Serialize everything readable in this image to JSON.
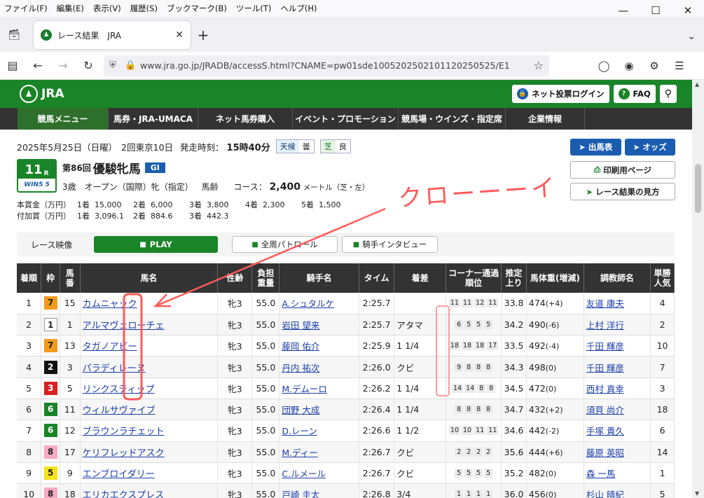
{
  "browser": {
    "menu": [
      "ファイル(F)",
      "編集(E)",
      "表示(V)",
      "履歴(S)",
      "ブックマーク(B)",
      "ツール(T)",
      "ヘルプ(H)"
    ],
    "tab_title": "レース結果　JRA",
    "url": "www.jra.go.jp/JRADB/accessS.html?CNAME=pw01sde1005202502101120250525/E1"
  },
  "site": {
    "logo": "JRA",
    "login_btn": "ネット投票ログイン",
    "faq_btn": "FAQ",
    "nav": [
      "競馬メニュー",
      "馬券・JRA-UMACA",
      "ネット馬券購入",
      "イベント・プロモーション",
      "競馬場・ウインズ・指定席",
      "企業情報"
    ]
  },
  "race": {
    "date": "2025年5月25日（日曜）",
    "meeting": "2回東京10日",
    "start_label": "発走時刻：",
    "start_time": "15時40分",
    "weather_label": "天候",
    "weather": "曇",
    "turf_label": "芝",
    "track": "良",
    "race_no": "11",
    "race_no_r": "R",
    "win5": "WIN5 5",
    "kai": "第86回",
    "name": "優駿牝馬",
    "grade": "GI",
    "age": "3歳",
    "cls": "オープン（国際）牝（指定）",
    "weight_rule": "馬齢",
    "course_label": "コース：",
    "distance": "2,400",
    "unit": "メートル（芝・左）",
    "prize_label": "本賞金（万円）",
    "prize": [
      "1着  15,000",
      "2着  6,000",
      "3着  3,800",
      "4着  2,300",
      "5着  1,500"
    ],
    "addprize_label": "付加賞（万円）",
    "addprize": [
      "1着  3,096.1",
      "2着  884.6",
      "3着  442.3"
    ]
  },
  "buttons": {
    "shutuba": "出馬表",
    "odds": "オッズ",
    "print": "印刷用ページ",
    "howto": "レース結果の見方"
  },
  "video": {
    "label": "レース映像",
    "play": "PLAY",
    "patrol": "全周パトロール",
    "interview": "騎手インタビュー"
  },
  "table": {
    "headers": [
      "着順",
      "枠",
      "馬番",
      "馬名",
      "性齢",
      "負担重量",
      "騎手名",
      "タイム",
      "着差",
      "コーナー通過順位",
      "推定上り",
      "馬体重(増減)",
      "調教師名",
      "単勝人気"
    ],
    "rows": [
      {
        "rank": "1",
        "waku": "7",
        "num": "15",
        "horse": "カムニャック",
        "sex": "牝3",
        "wt": "55.0",
        "jockey": "A.シュタルケ",
        "time": "2:25.7",
        "margin": "",
        "corner": [
          "11",
          "11",
          "12",
          "11"
        ],
        "last": "33.8",
        "bw": "474",
        "bwd": "(+4)",
        "trainer": "友道 康夫",
        "pop": "4"
      },
      {
        "rank": "2",
        "waku": "1",
        "num": "1",
        "horse": "アルマヴェローチェ",
        "sex": "牝3",
        "wt": "55.0",
        "jockey": "岩田 望来",
        "time": "2:25.7",
        "margin": "アタマ",
        "corner": [
          "6",
          "5",
          "5",
          "5"
        ],
        "last": "34.2",
        "bw": "490",
        "bwd": "(-6)",
        "trainer": "上村 洋行",
        "pop": "2"
      },
      {
        "rank": "3",
        "waku": "7",
        "num": "13",
        "horse": "タガノアビー",
        "sex": "牝3",
        "wt": "55.0",
        "jockey": "藤岡 佑介",
        "time": "2:25.9",
        "margin": "1 1/4",
        "corner": [
          "18",
          "18",
          "18",
          "17"
        ],
        "last": "33.5",
        "bw": "492",
        "bwd": "(-4)",
        "trainer": "千田 輝彦",
        "pop": "10"
      },
      {
        "rank": "4",
        "waku": "2",
        "num": "3",
        "horse": "パラディレーヌ",
        "sex": "牝3",
        "wt": "55.0",
        "jockey": "丹内 祐次",
        "time": "2:26.0",
        "margin": "クビ",
        "corner": [
          "9",
          "8",
          "8",
          "8"
        ],
        "last": "34.3",
        "bw": "498",
        "bwd": "(0)",
        "trainer": "千田 輝彦",
        "pop": "7"
      },
      {
        "rank": "5",
        "waku": "3",
        "num": "5",
        "horse": "リンクスティップ",
        "sex": "牝3",
        "wt": "55.0",
        "jockey": "M.デムーロ",
        "time": "2:26.2",
        "margin": "1 1/4",
        "corner": [
          "14",
          "14",
          "8",
          "8"
        ],
        "last": "34.5",
        "bw": "472",
        "bwd": "(0)",
        "trainer": "西村 真幸",
        "pop": "3"
      },
      {
        "rank": "6",
        "waku": "6",
        "num": "11",
        "horse": "ウィルサヴァイブ",
        "sex": "牝3",
        "wt": "55.0",
        "jockey": "団野 大成",
        "time": "2:26.4",
        "margin": "1 1/4",
        "corner": [
          "8",
          "8",
          "8",
          "8"
        ],
        "last": "34.7",
        "bw": "432",
        "bwd": "(+2)",
        "trainer": "須貝 尚介",
        "pop": "18"
      },
      {
        "rank": "7",
        "waku": "6",
        "num": "12",
        "horse": "ブラウンラチェット",
        "sex": "牝3",
        "wt": "55.0",
        "jockey": "D.レーン",
        "time": "2:26.6",
        "margin": "1 1/2",
        "corner": [
          "10",
          "10",
          "11",
          "11"
        ],
        "last": "34.6",
        "bw": "442",
        "bwd": "(-2)",
        "trainer": "手塚 貴久",
        "pop": "6"
      },
      {
        "rank": "8",
        "waku": "8",
        "num": "17",
        "horse": "ケリフレッドアスク",
        "sex": "牝3",
        "wt": "55.0",
        "jockey": "M.ディー",
        "time": "2:26.7",
        "margin": "クビ",
        "corner": [
          "2",
          "2",
          "2",
          "2"
        ],
        "last": "35.6",
        "bw": "444",
        "bwd": "(+6)",
        "trainer": "藤原 英昭",
        "pop": "14"
      },
      {
        "rank": "9",
        "waku": "5",
        "num": "9",
        "horse": "エンブロイダリー",
        "sex": "牝3",
        "wt": "55.0",
        "jockey": "C.ルメール",
        "time": "2:26.7",
        "margin": "クビ",
        "corner": [
          "5",
          "5",
          "5",
          "5"
        ],
        "last": "35.2",
        "bw": "482",
        "bwd": "(0)",
        "trainer": "森 一馬",
        "pop": "1"
      },
      {
        "rank": "10",
        "waku": "8",
        "num": "18",
        "horse": "エリカエクスプレス",
        "sex": "牝3",
        "wt": "55.0",
        "jockey": "戸崎 圭太",
        "time": "2:26.8",
        "margin": "3/4",
        "corner": [
          "1",
          "1",
          "1",
          "1"
        ],
        "last": "36.0",
        "bw": "456",
        "bwd": "(0)",
        "trainer": "杉山 晴紀",
        "pop": "5"
      }
    ]
  },
  "annotation": {
    "text": "クローーーイ",
    "color": "#ff5a5a"
  },
  "colors": {
    "jra_green": "#1a8428",
    "nav_dark": "#333333",
    "blue_btn": "#1a5db0",
    "link": "#1a3ea8",
    "waku": {
      "1": [
        "#ffffff",
        "#222222"
      ],
      "2": [
        "#111111",
        "#ffffff"
      ],
      "3": [
        "#d82020",
        "#ffffff"
      ],
      "4": [
        "#1a5db0",
        "#ffffff"
      ],
      "5": [
        "#f5e21a",
        "#222222"
      ],
      "6": [
        "#1a8428",
        "#ffffff"
      ],
      "7": [
        "#f39a1a",
        "#222222"
      ],
      "8": [
        "#f8aac4",
        "#222222"
      ]
    }
  }
}
